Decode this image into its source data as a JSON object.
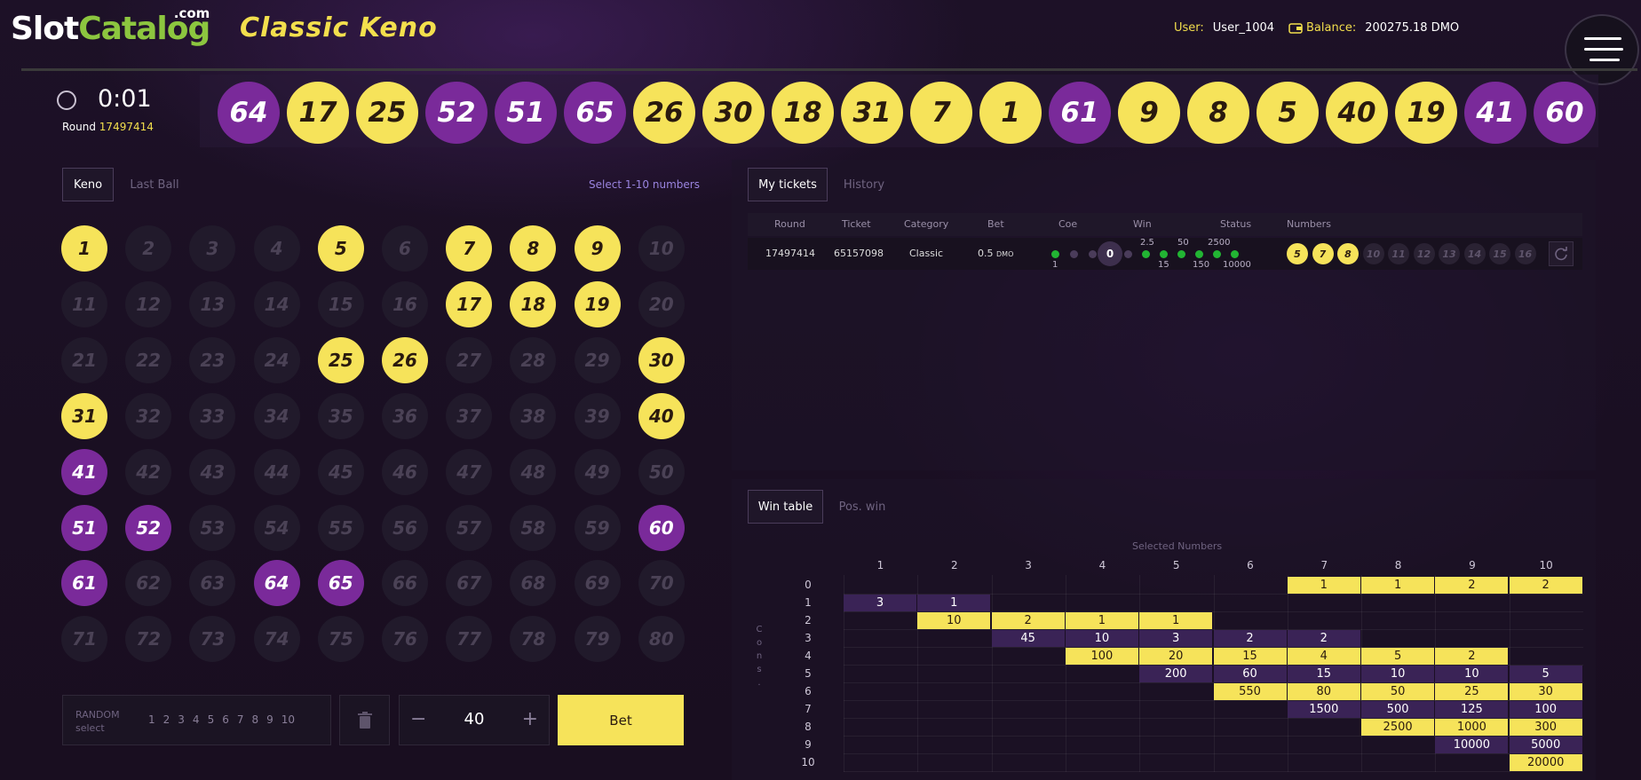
{
  "header": {
    "logo": {
      "slot": "Slot",
      "catalog": "Catalog",
      "com": ".com"
    },
    "game_title": "Classic Keno",
    "user_label": "User:",
    "user_value": "User_1004",
    "balance_label": "Balance:",
    "balance_value": "200275.18 DMO"
  },
  "timer": {
    "time": "0:01",
    "round_label": "Round",
    "round_value": "17497414"
  },
  "drawn_numbers": [
    {
      "n": "64",
      "c": "purple"
    },
    {
      "n": "17",
      "c": "yellow"
    },
    {
      "n": "25",
      "c": "yellow"
    },
    {
      "n": "52",
      "c": "purple"
    },
    {
      "n": "51",
      "c": "purple"
    },
    {
      "n": "65",
      "c": "purple"
    },
    {
      "n": "26",
      "c": "yellow"
    },
    {
      "n": "30",
      "c": "yellow"
    },
    {
      "n": "18",
      "c": "yellow"
    },
    {
      "n": "31",
      "c": "yellow"
    },
    {
      "n": "7",
      "c": "yellow"
    },
    {
      "n": "1",
      "c": "yellow"
    },
    {
      "n": "61",
      "c": "purple"
    },
    {
      "n": "9",
      "c": "yellow"
    },
    {
      "n": "8",
      "c": "yellow"
    },
    {
      "n": "5",
      "c": "yellow"
    },
    {
      "n": "40",
      "c": "yellow"
    },
    {
      "n": "19",
      "c": "yellow"
    },
    {
      "n": "41",
      "c": "purple"
    },
    {
      "n": "60",
      "c": "purple"
    }
  ],
  "left_tabs": {
    "keno": "Keno",
    "last_ball": "Last Ball",
    "hint": "Select 1-10 numbers"
  },
  "board": {
    "yellow": [
      1,
      5,
      7,
      8,
      9,
      17,
      18,
      19,
      25,
      26,
      30,
      31,
      40
    ],
    "purple": [
      41,
      51,
      52,
      60,
      61,
      64,
      65
    ]
  },
  "controls": {
    "random_label": "RANDOM",
    "random_sub": "select",
    "random_numbers": [
      "1",
      "2",
      "3",
      "4",
      "5",
      "6",
      "7",
      "8",
      "9",
      "10"
    ],
    "minus": "−",
    "plus": "+",
    "stake": "40",
    "bet_label": "Bet"
  },
  "tickets": {
    "tab_my": "My tickets",
    "tab_history": "History",
    "columns": [
      "Round",
      "Ticket",
      "Category",
      "Bet",
      "Coe",
      "Win",
      "Status",
      "Numbers"
    ],
    "row": {
      "round": "17497414",
      "ticket": "65157098",
      "category": "Classic",
      "bet": "0.5",
      "bet_unit": "DMO",
      "coe": "0",
      "coe_low": "1",
      "win_top": [
        "2.5",
        "50",
        "2500"
      ],
      "win_bottom": [
        "15",
        "150",
        "10000"
      ],
      "numbers": [
        {
          "n": "5",
          "s": "y"
        },
        {
          "n": "7",
          "s": "y"
        },
        {
          "n": "8",
          "s": "y"
        },
        {
          "n": "10",
          "s": "o"
        },
        {
          "n": "11",
          "s": "o"
        },
        {
          "n": "12",
          "s": "o"
        },
        {
          "n": "13",
          "s": "o"
        },
        {
          "n": "14",
          "s": "o"
        },
        {
          "n": "15",
          "s": "o"
        },
        {
          "n": "16",
          "s": "o"
        }
      ]
    }
  },
  "win_table": {
    "tab_win": "Win table",
    "tab_pos": "Pos. win",
    "caption": "Selected Numbers",
    "side_label": [
      "C",
      "o",
      "n",
      "s",
      "."
    ],
    "columns": [
      "1",
      "2",
      "3",
      "4",
      "5",
      "6",
      "7",
      "8",
      "9",
      "10"
    ],
    "rows": [
      "0",
      "1",
      "2",
      "3",
      "4",
      "5",
      "6",
      "7",
      "8",
      "9",
      "10"
    ],
    "cells": [
      {
        "r": 0,
        "c": 7,
        "v": "1",
        "s": "y"
      },
      {
        "r": 0,
        "c": 8,
        "v": "1",
        "s": "y"
      },
      {
        "r": 0,
        "c": 9,
        "v": "2",
        "s": "y"
      },
      {
        "r": 0,
        "c": 10,
        "v": "2",
        "s": "y"
      },
      {
        "r": 1,
        "c": 1,
        "v": "3",
        "s": "p"
      },
      {
        "r": 1,
        "c": 2,
        "v": "1",
        "s": "p"
      },
      {
        "r": 2,
        "c": 2,
        "v": "10",
        "s": "y"
      },
      {
        "r": 2,
        "c": 3,
        "v": "2",
        "s": "y"
      },
      {
        "r": 2,
        "c": 4,
        "v": "1",
        "s": "y"
      },
      {
        "r": 2,
        "c": 5,
        "v": "1",
        "s": "y"
      },
      {
        "r": 3,
        "c": 3,
        "v": "45",
        "s": "p"
      },
      {
        "r": 3,
        "c": 4,
        "v": "10",
        "s": "p"
      },
      {
        "r": 3,
        "c": 5,
        "v": "3",
        "s": "p"
      },
      {
        "r": 3,
        "c": 6,
        "v": "2",
        "s": "p"
      },
      {
        "r": 3,
        "c": 7,
        "v": "2",
        "s": "p"
      },
      {
        "r": 4,
        "c": 4,
        "v": "100",
        "s": "y"
      },
      {
        "r": 4,
        "c": 5,
        "v": "20",
        "s": "y"
      },
      {
        "r": 4,
        "c": 6,
        "v": "15",
        "s": "y"
      },
      {
        "r": 4,
        "c": 7,
        "v": "4",
        "s": "y"
      },
      {
        "r": 4,
        "c": 8,
        "v": "5",
        "s": "y"
      },
      {
        "r": 4,
        "c": 9,
        "v": "2",
        "s": "y"
      },
      {
        "r": 5,
        "c": 5,
        "v": "200",
        "s": "p"
      },
      {
        "r": 5,
        "c": 6,
        "v": "60",
        "s": "p"
      },
      {
        "r": 5,
        "c": 7,
        "v": "15",
        "s": "p"
      },
      {
        "r": 5,
        "c": 8,
        "v": "10",
        "s": "p"
      },
      {
        "r": 5,
        "c": 9,
        "v": "10",
        "s": "p"
      },
      {
        "r": 5,
        "c": 10,
        "v": "5",
        "s": "p"
      },
      {
        "r": 6,
        "c": 6,
        "v": "550",
        "s": "y"
      },
      {
        "r": 6,
        "c": 7,
        "v": "80",
        "s": "y"
      },
      {
        "r": 6,
        "c": 8,
        "v": "50",
        "s": "y"
      },
      {
        "r": 6,
        "c": 9,
        "v": "25",
        "s": "y"
      },
      {
        "r": 6,
        "c": 10,
        "v": "30",
        "s": "y"
      },
      {
        "r": 7,
        "c": 7,
        "v": "1500",
        "s": "p"
      },
      {
        "r": 7,
        "c": 8,
        "v": "500",
        "s": "p"
      },
      {
        "r": 7,
        "c": 9,
        "v": "125",
        "s": "p"
      },
      {
        "r": 7,
        "c": 10,
        "v": "100",
        "s": "p"
      },
      {
        "r": 8,
        "c": 8,
        "v": "2500",
        "s": "y"
      },
      {
        "r": 8,
        "c": 9,
        "v": "1000",
        "s": "y"
      },
      {
        "r": 8,
        "c": 10,
        "v": "300",
        "s": "y"
      },
      {
        "r": 9,
        "c": 9,
        "v": "10000",
        "s": "p"
      },
      {
        "r": 9,
        "c": 10,
        "v": "5000",
        "s": "p"
      },
      {
        "r": 10,
        "c": 10,
        "v": "20000",
        "s": "y"
      }
    ]
  },
  "colors": {
    "yellow": "#f6e35a",
    "purple": "#7a2a9a",
    "accent": "#9a84e0",
    "green": "#22b533"
  }
}
